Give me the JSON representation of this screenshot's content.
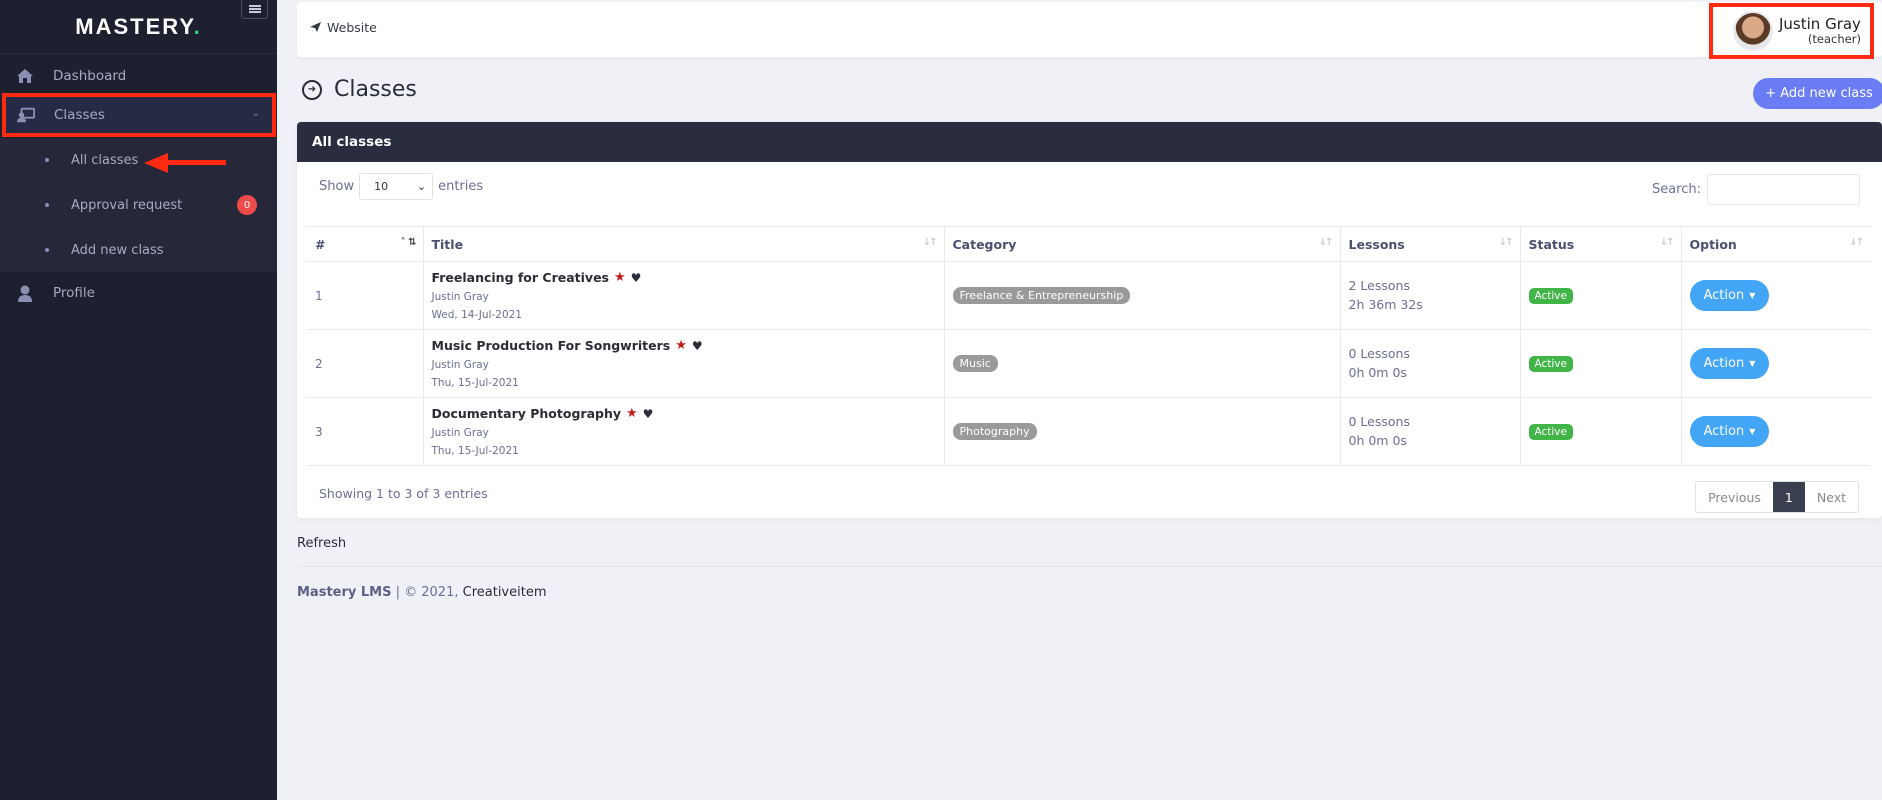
{
  "sidebar": {
    "logo": "MASTERY",
    "logo_dot": ".",
    "items": [
      {
        "label": "Dashboard",
        "icon": "home-icon"
      },
      {
        "label": "Classes",
        "icon": "chalkboard-teacher-icon",
        "expanded": true
      },
      {
        "label": "Profile",
        "icon": "user-icon"
      }
    ],
    "submenu": [
      {
        "label": "All classes",
        "active": true
      },
      {
        "label": "Approval request",
        "badge": "0"
      },
      {
        "label": "Add new class"
      }
    ]
  },
  "topbar": {
    "website_label": "Website",
    "user_name": "Justin Gray",
    "user_role": "(teacher)"
  },
  "page": {
    "title": "Classes",
    "add_button": "+ Add new class"
  },
  "card": {
    "header": "All classes",
    "show_label": "Show",
    "entries_label": "entries",
    "page_size": "10",
    "search_label": "Search:",
    "search_value": "",
    "columns": [
      "#",
      "Title",
      "Category",
      "Lessons",
      "Status",
      "Option"
    ],
    "rows": [
      {
        "num": "1",
        "title": "Freelancing for Creatives",
        "author": "Justin Gray",
        "date": "Wed, 14-Jul-2021",
        "category": "Freelance & Entrepreneurship",
        "lessons": "2 Lessons",
        "duration": "2h 36m 32s",
        "status": "Active",
        "action": "Action"
      },
      {
        "num": "2",
        "title": "Music Production For Songwriters",
        "author": "Justin Gray",
        "date": "Thu, 15-Jul-2021",
        "category": "Music",
        "lessons": "0 Lessons",
        "duration": "0h 0m 0s",
        "status": "Active",
        "action": "Action"
      },
      {
        "num": "3",
        "title": "Documentary Photography",
        "author": "Justin Gray",
        "date": "Thu, 15-Jul-2021",
        "category": "Photography",
        "lessons": "0 Lessons",
        "duration": "0h 0m 0s",
        "status": "Active",
        "action": "Action"
      }
    ],
    "info": "Showing 1 to 3 of 3 entries",
    "pager": {
      "previous": "Previous",
      "current": "1",
      "next": "Next"
    }
  },
  "refresh_label": "Refresh",
  "footer": {
    "brand": "Mastery LMS",
    "separator": " | © 2021, ",
    "company": "Creativeitem"
  },
  "colors": {
    "accent": "#6a7df5",
    "action": "#42a5f5",
    "active": "#42b549",
    "highlight": "#ff2a10"
  }
}
